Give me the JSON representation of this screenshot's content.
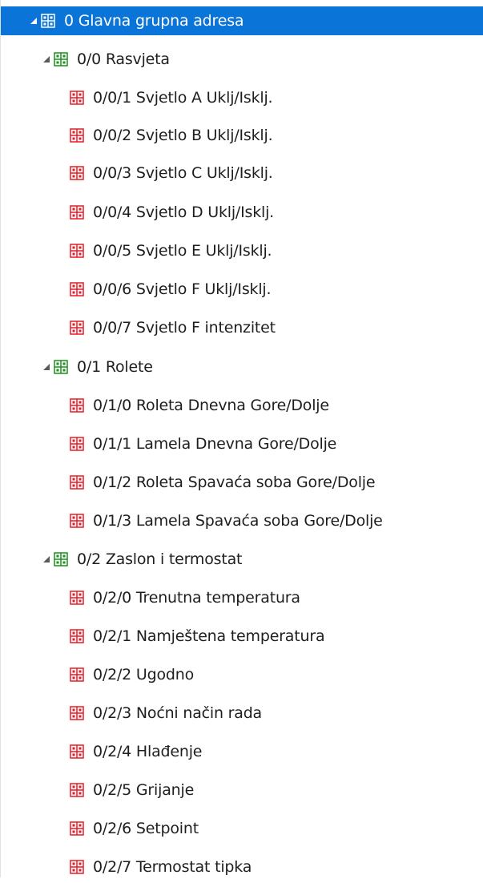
{
  "tree": {
    "root": {
      "label": "0 Glavna grupna adresa",
      "icon": "group-address-blue-icon",
      "expanded": true,
      "selected": true
    },
    "groups": [
      {
        "label": "0/0 Rasvjeta",
        "icon": "group-address-green-icon",
        "expanded": true,
        "items": [
          {
            "label": "0/0/1 Svjetlo A Uklj/Isklj.",
            "icon": "group-address-red-icon"
          },
          {
            "label": "0/0/2 Svjetlo B Uklj/Isklj.",
            "icon": "group-address-red-icon"
          },
          {
            "label": "0/0/3 Svjetlo C Uklj/Isklj.",
            "icon": "group-address-red-icon"
          },
          {
            "label": "0/0/4 Svjetlo D Uklj/Isklj.",
            "icon": "group-address-red-icon"
          },
          {
            "label": "0/0/5 Svjetlo E Uklj/Isklj.",
            "icon": "group-address-red-icon"
          },
          {
            "label": "0/0/6 Svjetlo F Uklj/Isklj.",
            "icon": "group-address-red-icon"
          },
          {
            "label": "0/0/7 Svjetlo F intenzitet",
            "icon": "group-address-red-icon"
          }
        ]
      },
      {
        "label": "0/1 Rolete",
        "icon": "group-address-green-icon",
        "expanded": true,
        "items": [
          {
            "label": "0/1/0 Roleta Dnevna Gore/Dolje",
            "icon": "group-address-red-icon"
          },
          {
            "label": "0/1/1 Lamela Dnevna Gore/Dolje",
            "icon": "group-address-red-icon"
          },
          {
            "label": "0/1/2 Roleta Spavaća soba Gore/Dolje",
            "icon": "group-address-red-icon"
          },
          {
            "label": "0/1/3 Lamela Spavaća soba Gore/Dolje",
            "icon": "group-address-red-icon"
          }
        ]
      },
      {
        "label": "0/2 Zaslon i termostat",
        "icon": "group-address-green-icon",
        "expanded": true,
        "items": [
          {
            "label": "0/2/0 Trenutna temperatura",
            "icon": "group-address-red-icon"
          },
          {
            "label": "0/2/1 Namještena temperatura",
            "icon": "group-address-red-icon"
          },
          {
            "label": "0/2/2 Ugodno",
            "icon": "group-address-red-icon"
          },
          {
            "label": "0/2/3 Noćni način rada",
            "icon": "group-address-red-icon"
          },
          {
            "label": "0/2/4 Hlađenje",
            "icon": "group-address-red-icon"
          },
          {
            "label": "0/2/5 Grijanje",
            "icon": "group-address-red-icon"
          },
          {
            "label": "0/2/6 Setpoint",
            "icon": "group-address-red-icon"
          },
          {
            "label": "0/2/7 Termostat tipka",
            "icon": "group-address-red-icon"
          }
        ]
      }
    ]
  },
  "colors": {
    "selection": "#0a74d8",
    "root_icon": "#2d2dcf",
    "middle_icon": "#1c8f1c",
    "leaf_icon": "#e31b23",
    "expander": "#5a5a5a"
  }
}
